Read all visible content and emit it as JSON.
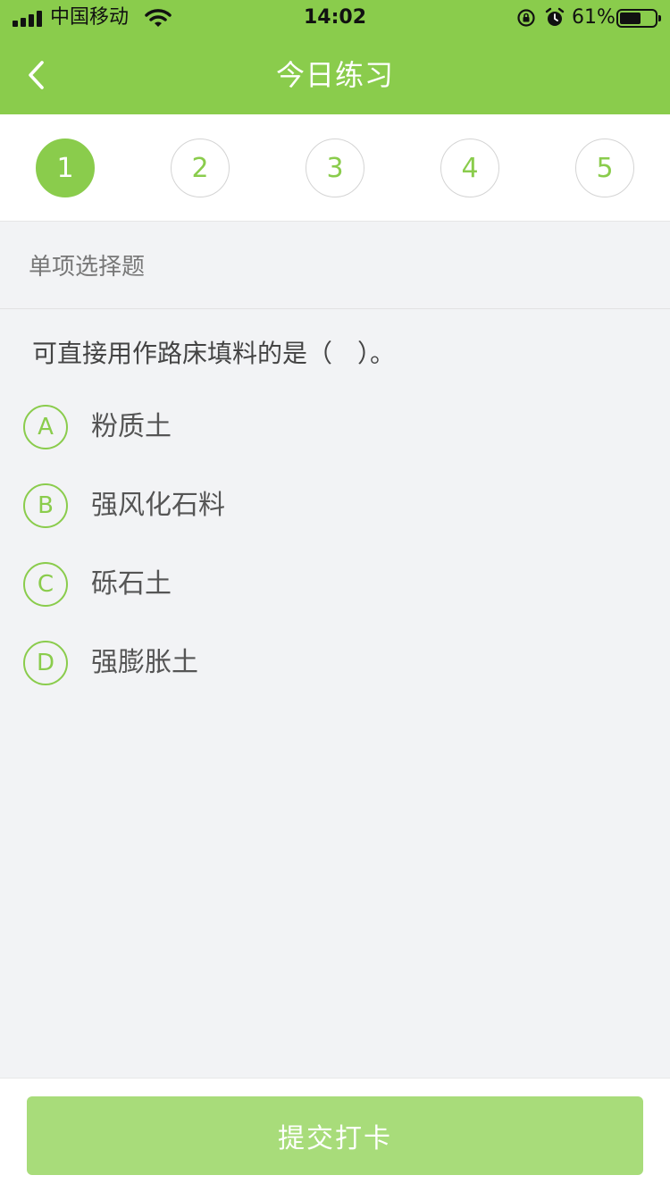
{
  "status_bar": {
    "carrier": "中国移动",
    "time": "14:02",
    "battery_percent": "61%",
    "battery_level": 0.61
  },
  "nav": {
    "title": "今日练习",
    "back_icon": "chevron-left-icon"
  },
  "steps": {
    "items": [
      "1",
      "2",
      "3",
      "4",
      "5"
    ],
    "active_index": 0,
    "accent": "#8acc4c"
  },
  "question": {
    "type_label": "单项选择题",
    "text": "可直接用作路床填料的是（　）。",
    "options": [
      {
        "letter": "A",
        "text": "粉质土"
      },
      {
        "letter": "B",
        "text": "强风化石料"
      },
      {
        "letter": "C",
        "text": "砾石土"
      },
      {
        "letter": "D",
        "text": "强膨胀土"
      }
    ]
  },
  "footer": {
    "submit_label": "提交打卡"
  },
  "colors": {
    "primary": "#8acc4c",
    "button_disabled": "#a8dc7a",
    "background": "#f2f3f5"
  }
}
